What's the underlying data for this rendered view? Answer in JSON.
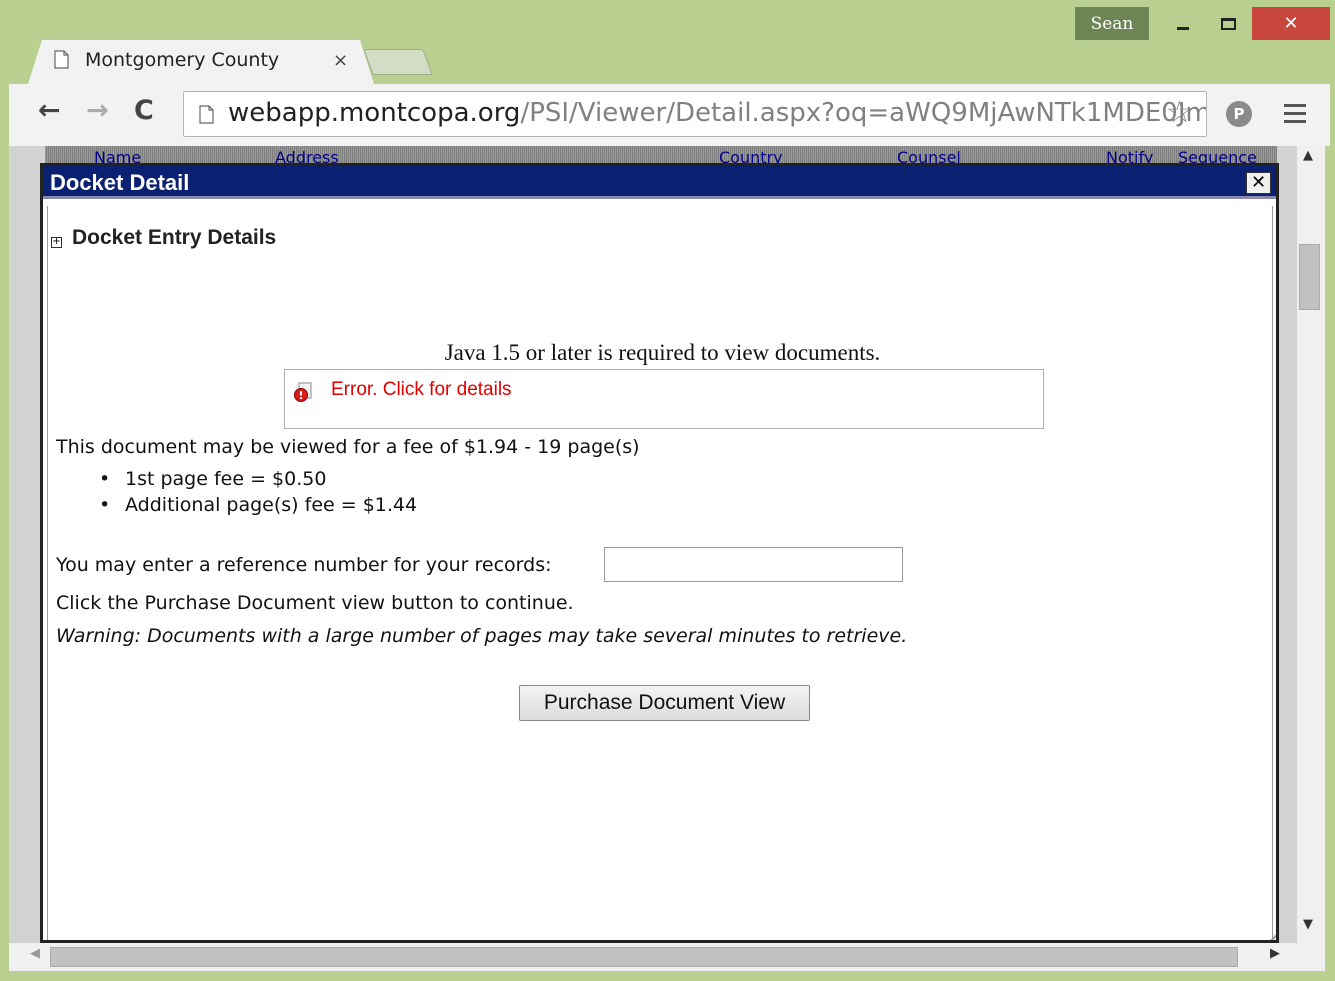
{
  "window": {
    "profile_name": "Sean",
    "minimize_glyph": "_",
    "maximize_glyph": "□",
    "close_glyph": "✕"
  },
  "tab": {
    "title": "Montgomery County",
    "close_glyph": "×"
  },
  "toolbar": {
    "back_glyph": "←",
    "forward_glyph": "→",
    "reload_glyph": "C",
    "url_host": "webapp.montcopa.org",
    "url_path": "/PSI/Viewer/Detail.aspx?oq=aWQ9MjAwNTk1MDE0Jm\\",
    "star_glyph": "☆",
    "extension_glyph": "P"
  },
  "background_table": {
    "headers": [
      "Name",
      "Address",
      "Country",
      "Counsel",
      "Notify",
      "Sequence"
    ]
  },
  "dialog": {
    "title": "Docket Detail",
    "close_glyph": "✕",
    "expander_glyph": "+",
    "section_title": "Docket Entry Details",
    "java_message": "Java 1.5 or later is required to view documents.",
    "error_text": "Error. Click for details",
    "fee_line": "This document may be viewed for a fee of $1.94 - 19 page(s)",
    "fee_items": [
      "1st page fee = $0.50",
      "Additional page(s) fee = $1.44"
    ],
    "reference_label": "You may enter a reference number for your records:",
    "reference_value": "",
    "continue_line": "Click the Purchase Document view button to continue.",
    "warning_line": "Warning: Documents with a large number of pages may take several minutes to retrieve.",
    "purchase_button": "Purchase Document View"
  },
  "colors": {
    "window_frame": "#b9d090",
    "dialog_titlebar": "#0a2070",
    "error_text": "#e00000",
    "close_button": "#c9463d"
  }
}
